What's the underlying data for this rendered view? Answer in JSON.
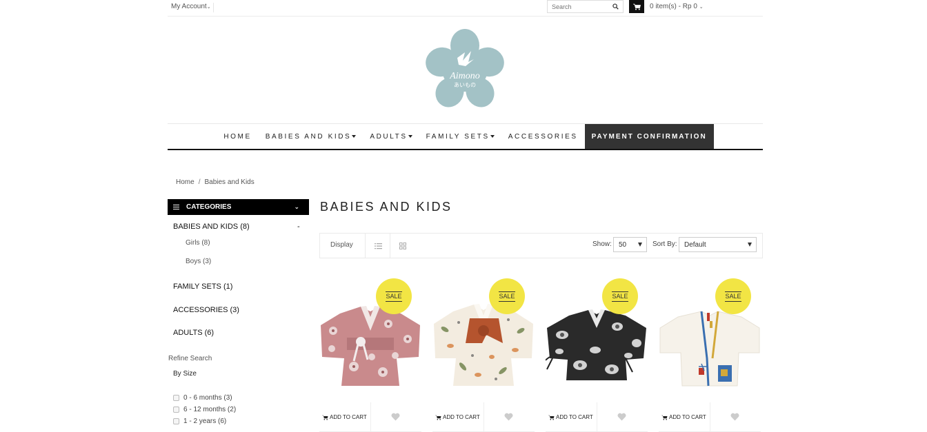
{
  "topbar": {
    "my_account": "My Account",
    "search_placeholder": "Search",
    "cart_text": "0 item(s) - Rp 0"
  },
  "logo": {
    "brand": "Aimono",
    "brand_jp": "あいもの",
    "color": "#a3c2c6"
  },
  "nav": {
    "items": [
      {
        "label": "HOME",
        "dropdown": false
      },
      {
        "label": "BABIES AND KIDS",
        "dropdown": true
      },
      {
        "label": "ADULTS",
        "dropdown": true
      },
      {
        "label": "FAMILY SETS",
        "dropdown": true
      },
      {
        "label": "ACCESSORIES",
        "dropdown": false
      },
      {
        "label": "PAYMENT CONFIRMATION",
        "dropdown": false,
        "active": true
      }
    ]
  },
  "breadcrumb": {
    "items": [
      "Home",
      "Babies and Kids"
    ],
    "separator": "/"
  },
  "sidebar": {
    "header": "CATEGORIES",
    "categories": [
      {
        "label": "BABIES AND KIDS (8)",
        "toggle": "-",
        "children": [
          "Girls (8)",
          "Boys (3)"
        ]
      },
      {
        "label": "FAMILY SETS (1)"
      },
      {
        "label": "ACCESSORIES (3)"
      },
      {
        "label": "ADULTS (6)"
      }
    ],
    "refine_title": "Refine Search",
    "by_size": "By Size",
    "sizes": [
      "0 - 6 months (3)",
      "6 - 12 months (2)",
      "1 - 2 years (6)"
    ]
  },
  "main": {
    "title": "BABIES AND KIDS",
    "toolbar": {
      "display_label": "Display",
      "show_label": "Show:",
      "show_value": "50",
      "sort_label": "Sort By:",
      "sort_value": "Default"
    },
    "products": [
      {
        "badge": "SALE",
        "add_to_cart": "ADD TO CART",
        "image": "pink-floral-kimono"
      },
      {
        "badge": "SALE",
        "add_to_cart": "ADD TO CART",
        "image": "cream-leaf-kimono"
      },
      {
        "badge": "SALE",
        "add_to_cart": "ADD TO CART",
        "image": "black-white-kimono"
      },
      {
        "badge": "SALE",
        "add_to_cart": "ADD TO CART",
        "image": "white-kimono-jacket"
      }
    ]
  },
  "colors": {
    "sale_badge": "#f2e544",
    "nav_active_bg": "#333333",
    "category_header_bg": "#000000"
  }
}
